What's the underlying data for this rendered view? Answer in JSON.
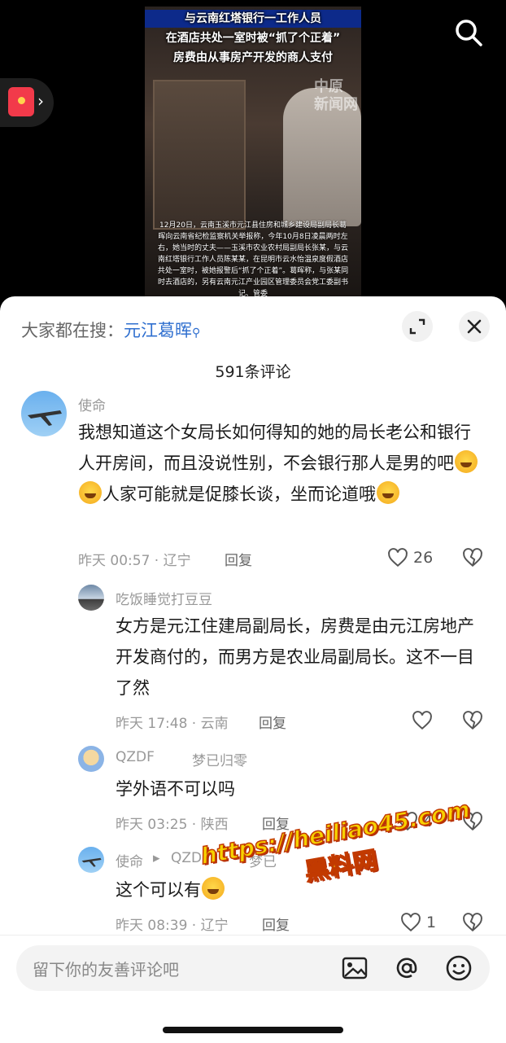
{
  "video": {
    "title_line1": "与云南红塔银行一工作人员",
    "title_line2": "在酒店共处一室时被“抓了个正着”",
    "title_line3": "房费由从事房产开发的商人支付",
    "watermark": "中原\n新闻网",
    "caption": "12月20日，云南玉溪市元江县住房和城乡建设局副局长葛晖向云南省纪检监察机关举报称，今年10月8日凌晨两时左右，她当时的丈夫——玉溪市农业农村局副局长张某，与云南红塔银行工作人员陈某某，在昆明市云水怡温泉度假酒店共处一室时，被她报警后“抓了个正着”。葛晖称，与张某同时去酒店的，另有云南元江产业园区管理委员会党工委副书记、管委"
  },
  "hot_search": {
    "prefix": "大家都在搜：",
    "keyword": "元江葛晖"
  },
  "comment_count": "591条评论",
  "comments": [
    {
      "user": "使命",
      "text_a": "我想知道这个女局长如何得知的她的局长老公和银行人开房间，而且没说性别，不会银行那人是男的吧",
      "text_b": "人家可能就是促膝长谈，坐而论道哦",
      "time_loc": "昨天 00:57 · 辽宁",
      "reply": "回复",
      "likes": "26"
    },
    {
      "user": "吃饭睡觉打豆豆",
      "text": "女方是元江住建局副局长，房费是由元江房地产开发商付的，而男方是农业局副局长。这不一目了然",
      "time_loc": "昨天 17:48 · 云南",
      "reply": "回复",
      "likes": ""
    },
    {
      "user": "QZDF",
      "reply_to": "梦已归零",
      "text": "学外语不可以吗",
      "time_loc": "昨天 03:25 · 陕西",
      "reply": "回复",
      "likes": "4"
    },
    {
      "user": "使命",
      "arrow": "▸",
      "reply_to": "QZDF",
      "reply_to2": "梦已",
      "text": "这个可以有",
      "time_loc": "昨天 08:39 · 辽宁",
      "reply": "回复",
      "likes": "1"
    }
  ],
  "watermark_overlay": {
    "url": "https://heiliao45.com",
    "name": "黑料网"
  },
  "input": {
    "placeholder": "留下你的友善评论吧"
  },
  "colors": {
    "accent": "#2f6fcf",
    "sheet_bg": "#ffffff",
    "muted": "#999999"
  }
}
